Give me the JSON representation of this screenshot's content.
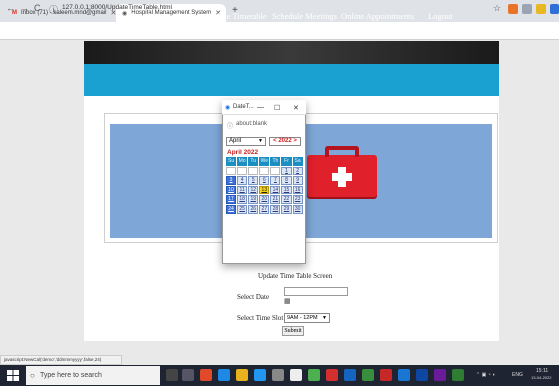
{
  "browser": {
    "tabs": [
      {
        "title": "Inbox (71) - kaleem.mnd@gmail",
        "favicon": "gmail-icon"
      },
      {
        "title": "Hospital Management System",
        "favicon": "chrome-page-icon"
      }
    ],
    "new_tab": "+",
    "url": "127.0.0.1:8000/UpdateTimeTable.html",
    "back": "←",
    "forward": "→",
    "reload": "C",
    "info": "ⓘ",
    "win_min": "—",
    "win_close": "✕",
    "bookmark": "☆"
  },
  "nav": {
    "items": [
      "View Patients Reports",
      "Update Timetable",
      "Schedule Meetings",
      "Online Appointments",
      "Logout"
    ]
  },
  "form": {
    "heading": "Update Time Table Screen",
    "date_label": "Select Date",
    "date_value": "",
    "time_label": "Select Time Slot",
    "time_value": "9AM - 12PM",
    "submit": "Submit"
  },
  "popup": {
    "title": "DateT...",
    "min": "—",
    "max": "☐",
    "close": "✕",
    "url": "about:blank",
    "month": "April",
    "year": "2022",
    "prev": "<",
    "next": ">",
    "month_heading": "April 2022",
    "weekday_headers": [
      "Su",
      "Mo",
      "Tu",
      "We",
      "Th",
      "Fr",
      "Sa"
    ],
    "weeks": [
      [
        "",
        "",
        "",
        "",
        "",
        "1",
        "2"
      ],
      [
        "3",
        "4",
        "5",
        "6",
        "7",
        "8",
        "9"
      ],
      [
        "10",
        "11",
        "12",
        "13",
        "14",
        "15",
        "16"
      ],
      [
        "17",
        "18",
        "19",
        "20",
        "21",
        "22",
        "23"
      ],
      [
        "24",
        "25",
        "26",
        "27",
        "28",
        "29",
        "30"
      ]
    ],
    "today": "13"
  },
  "status_bar": "javascript:NewCal('demo','ddmmmyyyy',false,24)",
  "taskbar": {
    "search_placeholder": "Type here to search",
    "time": "15:11",
    "date": "13-04-2022",
    "lang": "ENG"
  },
  "colors": {
    "nav_bg": "#1ba1d1",
    "hero_bg": "#7ea6d6",
    "medkit": "#e0202b",
    "today_highlight": "#f4d21a"
  }
}
